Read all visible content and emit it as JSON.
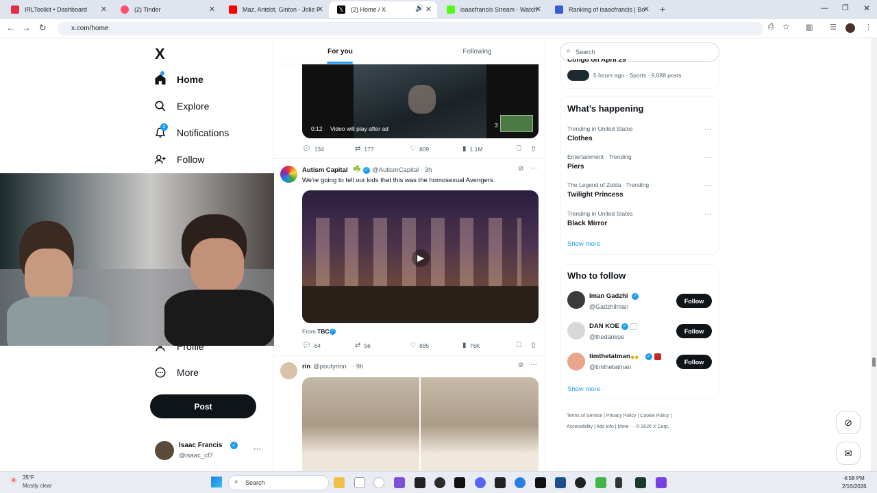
{
  "browser": {
    "tabs": [
      {
        "title": "IRLToolkit • Dashboard",
        "color": "#e32f45"
      },
      {
        "title": "(2) Tinder",
        "color": "#fd5068"
      },
      {
        "title": "Maz, Antdot, Ginton - Jolie Fille",
        "color": "#ff0000"
      },
      {
        "title": "(2) Home / X",
        "color": "#000000"
      },
      {
        "title": "isaacfrancis Stream - Watch Live",
        "color": "#53fc18"
      },
      {
        "title": "Ranking of isaacfrancis | BotRix",
        "color": "#3a5bd9"
      }
    ],
    "url": "x.com/home"
  },
  "sidebar": {
    "logo": "X",
    "items": [
      {
        "label": "Home",
        "icon": "home-icon"
      },
      {
        "label": "Explore",
        "icon": "search-icon"
      },
      {
        "label": "Notifications",
        "icon": "bell-icon",
        "badge": "2"
      },
      {
        "label": "Follow",
        "icon": "person-add-icon"
      },
      {
        "label": "Profile",
        "icon": "person-icon"
      },
      {
        "label": "More",
        "icon": "more-circle-icon"
      }
    ],
    "post_button": "Post",
    "account": {
      "name": "Isaac Francis",
      "handle": "@isaac_cf7",
      "more": "···"
    }
  },
  "feed": {
    "tabs": [
      "For you",
      "Following"
    ],
    "post1": {
      "time_overlay": "0:12",
      "overlay_text": "Video will play after ad",
      "count_badge": "3",
      "stats": {
        "replies": "134",
        "reposts": "177",
        "likes": "809",
        "views": "1.1M"
      }
    },
    "post2": {
      "name": "Autism Capital",
      "emoji": "☘️",
      "handle": "@AutismCapital",
      "time": "· 3h",
      "text": "We're going to tell our kids that this was the homosexual Avengers.",
      "from_label": "From",
      "from_name": "TBC",
      "stats": {
        "replies": "64",
        "reposts": "56",
        "likes": "885",
        "views": "76K"
      }
    },
    "post3": {
      "name": "rin",
      "handle": "@poutyrinn",
      "time": "· 9h"
    }
  },
  "right": {
    "search_placeholder": "Search",
    "top_card": {
      "title_fragment": "Congo on April 29",
      "meta": "5 hours ago · Sports · 9,088 posts"
    },
    "happening": {
      "title": "What’s happening",
      "trends": [
        {
          "context": "Trending in United States",
          "name": "Clothes"
        },
        {
          "context": "Entertainment · Trending",
          "name": "Piers"
        },
        {
          "context": "The Legend of Zelda · Trending",
          "name": "Twilight Princess"
        },
        {
          "context": "Trending in United States",
          "name": "Black Mirror"
        }
      ],
      "show_more": "Show more"
    },
    "who_to_follow": {
      "title": "Who to follow",
      "people": [
        {
          "name": "Iman Gadzhi",
          "handle": "@Gadzhilman",
          "button": "Follow"
        },
        {
          "name": "DAN KOE",
          "handle": "@thedankoe",
          "button": "Follow"
        },
        {
          "name": "timthetatman",
          "handle": "@timthetatman",
          "button": "Follow"
        }
      ],
      "show_more": "Show more"
    },
    "footer": [
      "Terms of Service",
      "Privacy Policy",
      "Cookie Policy",
      "Accessibility",
      "Ads info",
      "More ···",
      "© 2026 X Corp."
    ]
  },
  "taskbar": {
    "weather_temp": "35°F",
    "weather_desc": "Mostly clear",
    "search": "Search",
    "time": "4:58 PM",
    "date": "2/16/2026"
  }
}
